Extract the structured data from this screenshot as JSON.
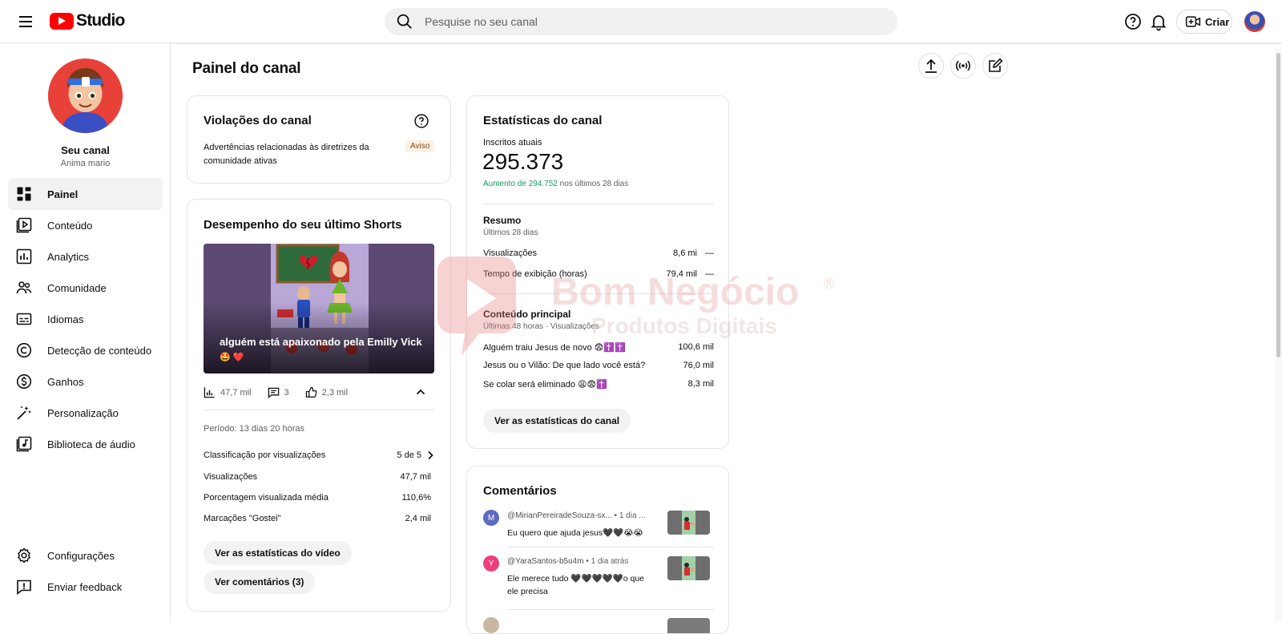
{
  "app": {
    "logo_text": "Studio",
    "brand_color": "#ff0000"
  },
  "search": {
    "placeholder": "Pesquise no seu canal"
  },
  "header": {
    "create_label": "Criar"
  },
  "channel": {
    "name": "Seu canal",
    "handle": "Anima mario"
  },
  "sidebar": {
    "items": [
      {
        "label": "Painel",
        "icon": "dashboard-icon",
        "active": true
      },
      {
        "label": "Conteúdo",
        "icon": "content-icon"
      },
      {
        "label": "Analytics",
        "icon": "analytics-icon"
      },
      {
        "label": "Comunidade",
        "icon": "community-icon"
      },
      {
        "label": "Idiomas",
        "icon": "subtitles-icon"
      },
      {
        "label": "Detecção de conteúdo",
        "icon": "copyright-icon"
      },
      {
        "label": "Ganhos",
        "icon": "earn-icon"
      },
      {
        "label": "Personalização",
        "icon": "customization-icon"
      },
      {
        "label": "Biblioteca de áudio",
        "icon": "audio-library-icon"
      }
    ],
    "bottom": [
      {
        "label": "Configurações",
        "icon": "settings-icon"
      },
      {
        "label": "Enviar feedback",
        "icon": "feedback-icon"
      }
    ]
  },
  "page": {
    "title": "Painel do canal"
  },
  "violations": {
    "title": "Violações do canal",
    "text": "Advertências relacionadas às diretrizes da comunidade ativas",
    "badge": "Aviso"
  },
  "shorts": {
    "title": "Desempenho do seu último Shorts",
    "video_title": "alguém está apaixonado pela Emilly Vick",
    "video_emoji": "🤩 ❤️",
    "views": "47,7 mil",
    "comments": "3",
    "likes": "2,3 mil",
    "period": "Período: 13 dias 20 horas",
    "rows": [
      {
        "label": "Classificação por visualizações",
        "value": "5 de 5"
      },
      {
        "label": "Visualizações",
        "value": "47,7 mil"
      },
      {
        "label": "Porcentagem visualizada média",
        "value": "110,6%"
      },
      {
        "label": "Marcações \"Gostei\"",
        "value": "2,4 mil"
      }
    ],
    "btn_stats": "Ver as estatísticas do vídeo",
    "btn_comments": "Ver comentários (3)"
  },
  "stats": {
    "title": "Estatísticas do canal",
    "subs_label": "Inscritos atuais",
    "subs_value": "295.373",
    "growth_prefix": "Aumento de 294.752",
    "growth_suffix": " nos últimos 28 dias",
    "summary_title": "Resumo",
    "summary_period": "Últimos 28 dias",
    "summary": [
      {
        "label": "Visualizações",
        "value": "8,6 mi",
        "trend": "—"
      },
      {
        "label": "Tempo de exibição (horas)",
        "value": "79,4 mil",
        "trend": "—"
      }
    ],
    "top_title": "Conteúdo principal",
    "top_period": "Últimas 48 horas · Visualizações",
    "top": [
      {
        "label": "Alguém traiu Jesus de novo 😨✝️✝️",
        "value": "100,6 mil"
      },
      {
        "label": "Jesus ou o Vilão: De que lado você está?",
        "value": "76,0 mil"
      },
      {
        "label": "Se colar será eliminado 😩😨✝️",
        "value": "8,3 mil"
      }
    ],
    "btn": "Ver as estatísticas do canal",
    "positive_color": "#0f9d58"
  },
  "comments": {
    "title": "Comentários",
    "items": [
      {
        "initial": "M",
        "color": "#5c6bc0",
        "author": "@MirianPereiradeSouza-sx...",
        "time": " • 1 dia ...",
        "text": "Eu quero que ajuda jesus🖤🖤😭😭"
      },
      {
        "initial": "Y",
        "color": "#ec407a",
        "author": "@YaraSantos-b5u4m",
        "time": " • 1 dia atrás",
        "text": "Ele merece tudo 🖤🖤🖤🖤🖤o que ele precisa"
      }
    ]
  },
  "watermark": {
    "line1": "Bom Negócio",
    "line2": "Produtos Digitais",
    "mark": "®"
  }
}
